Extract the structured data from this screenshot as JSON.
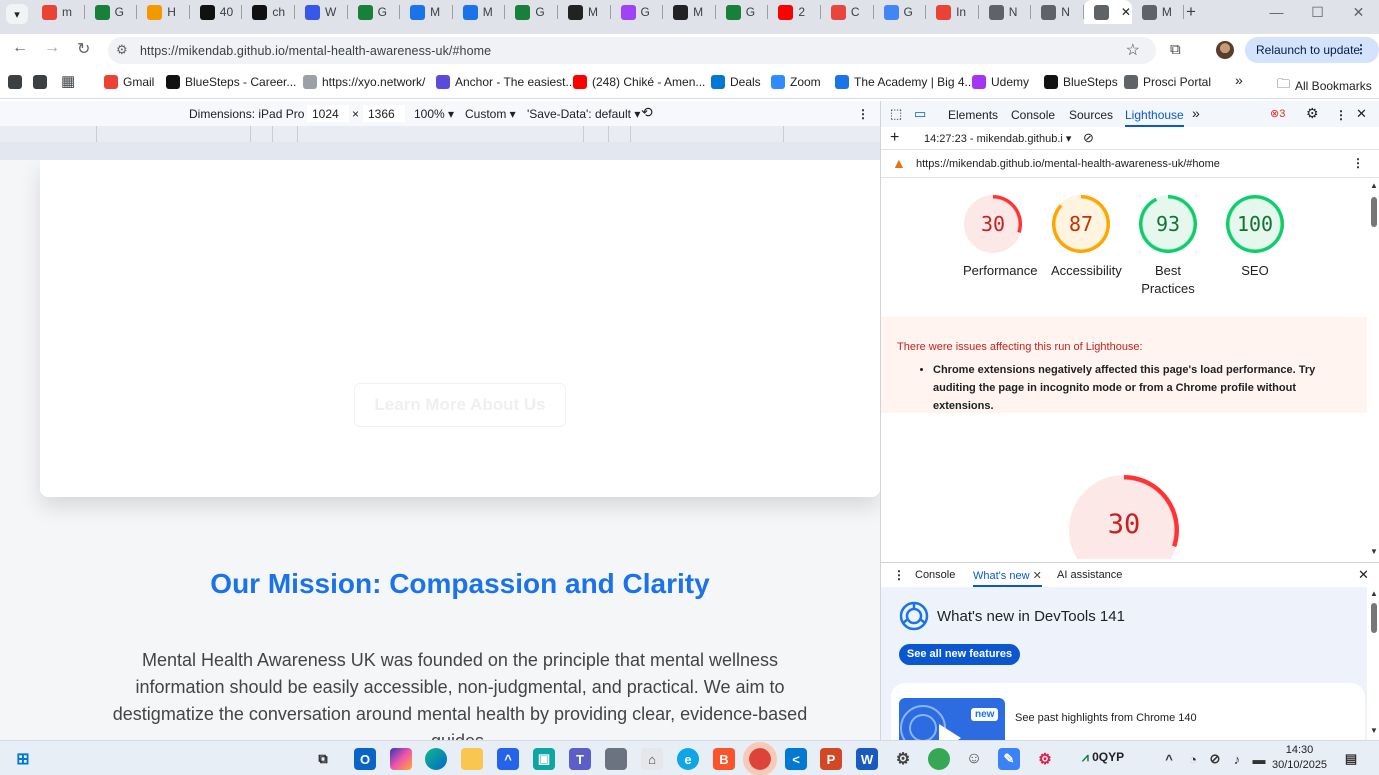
{
  "browser": {
    "tabs": [
      {
        "label": "m",
        "icon": "gmail-icon",
        "color": "#ea4335"
      },
      {
        "label": "G",
        "icon": "google-drive-icon",
        "color": "#188038"
      },
      {
        "label": "H",
        "icon": "hands-icon",
        "color": "#f29900"
      },
      {
        "label": "40",
        "icon": "bluesteps-icon",
        "color": "#111111"
      },
      {
        "label": "ch",
        "icon": "chatgpt-icon",
        "color": "#111111"
      },
      {
        "label": "W",
        "icon": "wordpress-icon",
        "color": "#3858e9"
      },
      {
        "label": "G",
        "icon": "google-drive-icon",
        "color": "#188038"
      },
      {
        "label": "M",
        "icon": "sf-icon",
        "color": "#1a73e8"
      },
      {
        "label": "M",
        "icon": "sf-icon",
        "color": "#1a73e8"
      },
      {
        "label": "G",
        "icon": "google-drive-icon",
        "color": "#188038"
      },
      {
        "label": "M",
        "icon": "medium-icon",
        "color": "#222222"
      },
      {
        "label": "G",
        "icon": "g-circle-icon",
        "color": "#a142f4"
      },
      {
        "label": "M",
        "icon": "medium-icon",
        "color": "#222222"
      },
      {
        "label": "G",
        "icon": "google-drive-icon",
        "color": "#188038"
      },
      {
        "label": "2",
        "icon": "youtube-icon",
        "color": "#ff0000"
      },
      {
        "label": "C",
        "icon": "opera-icon",
        "color": "#e8453c"
      },
      {
        "label": "G",
        "icon": "gemini-icon",
        "color": "#4285f4"
      },
      {
        "label": "In",
        "icon": "gmail-icon",
        "color": "#ea4335"
      },
      {
        "label": "N",
        "icon": "globe-icon",
        "color": "#5f6368"
      },
      {
        "label": "N",
        "icon": "globe-icon",
        "color": "#5f6368"
      },
      {
        "label": "",
        "icon": "globe-icon",
        "color": "#5f6368",
        "active": true
      },
      {
        "label": "M",
        "icon": "globe-icon",
        "color": "#5f6368"
      }
    ],
    "url": "https://mikendab.github.io/mental-health-awareness-uk/#home",
    "relaunch_label": "Relaunch to update",
    "bookmarks": [
      {
        "label": "Gmail",
        "icon": "gmail-icon",
        "color": "#ea4335"
      },
      {
        "label": "BlueSteps - Career...",
        "icon": "bluesteps-icon",
        "color": "#111111"
      },
      {
        "label": "https://xyo.network/",
        "icon": "xyo-icon",
        "color": "#9aa0a6"
      },
      {
        "label": "Anchor - The easiest...",
        "icon": "anchor-icon",
        "color": "#5b4bdb"
      },
      {
        "label": "(248) Chiké - Amen...",
        "icon": "youtube-icon",
        "color": "#ff0000"
      },
      {
        "label": "Deals",
        "icon": "windows-icon",
        "color": "#0078d4"
      },
      {
        "label": "Zoom",
        "icon": "zoom-icon",
        "color": "#2d8cff"
      },
      {
        "label": "The Academy | Big 4...",
        "icon": "academy-icon",
        "color": "#1a73e8"
      },
      {
        "label": "Udemy",
        "icon": "udemy-icon",
        "color": "#a435f0"
      },
      {
        "label": "BlueSteps",
        "icon": "bluesteps-icon",
        "color": "#111111"
      },
      {
        "label": "Prosci Portal",
        "icon": "prosci-icon",
        "color": "#5f6368"
      }
    ],
    "all_bookmarks_label": "All Bookmarks"
  },
  "device_toolbar": {
    "dimensions_label": "Dimensions: iPad Pro",
    "width": "1024",
    "height": "1366",
    "zoom": "100%",
    "throttling": "Custom",
    "save_data": "'Save-Data': default"
  },
  "page": {
    "learn_more_label": "Learn More About Us",
    "mission_title": "Our Mission: Compassion and Clarity",
    "mission_text": "Mental Health Awareness UK was founded on the principle that mental wellness information should be easily accessible, non-judgmental, and practical. We aim to destigmatize the conversation around mental health by providing clear, evidence-based guides."
  },
  "devtools": {
    "tabs": {
      "elements": "Elements",
      "console": "Console",
      "sources": "Sources",
      "lighthouse": "Lighthouse"
    },
    "error_count": "3",
    "report_time": "14:27:23 - mikendab.github.i",
    "report_url": "https://mikendab.github.io/mental-health-awareness-uk/#home",
    "scores": [
      {
        "label": "Performance",
        "value": 30,
        "color": "#f33",
        "bg": "#fde8e8",
        "text_color": "#c5221f"
      },
      {
        "label": "Accessibility",
        "value": 87,
        "color": "#ffa400",
        "bg": "#fff4e0",
        "text_color": "#c33300"
      },
      {
        "label": "Best Practices",
        "value": 93,
        "color": "#0cce6b",
        "bg": "#e6f7ed",
        "text_color": "#137333"
      },
      {
        "label": "SEO",
        "value": 100,
        "color": "#0cce6b",
        "bg": "#e6f7ed",
        "text_color": "#137333"
      }
    ],
    "issues_header": "There were issues affecting this run of Lighthouse:",
    "issues": [
      "Chrome extensions negatively affected this page's load performance. Try auditing the page in incognito mode or from a Chrome profile without extensions."
    ],
    "big_score": 30,
    "drawer_tabs": {
      "console": "Console",
      "whats_new": "What's new",
      "ai": "AI assistance"
    },
    "whats_new_title": "What's new in DevTools 141",
    "see_all_label": "See all new features",
    "new_badge": "new",
    "past_highlights": "See past highlights from Chrome 140"
  },
  "taskbar": {
    "stock": "0QYP",
    "time": "14:30",
    "date": "30/10/2025"
  }
}
